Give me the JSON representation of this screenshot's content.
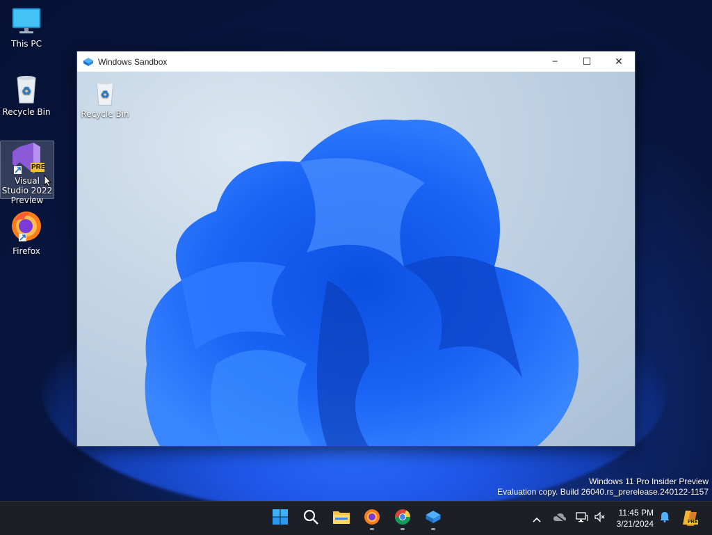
{
  "desktop": {
    "icons": [
      {
        "label": "This PC",
        "icon": "monitor-icon"
      },
      {
        "label": "Recycle Bin",
        "icon": "recycle-bin-icon"
      },
      {
        "label": "Visual Studio 2022 Preview",
        "icon": "visual-studio-icon",
        "badge": "PRE"
      },
      {
        "label": "Firefox",
        "icon": "firefox-icon"
      }
    ]
  },
  "sandbox_window": {
    "title": "Windows Sandbox",
    "controls": {
      "minimize": "─",
      "maximize": "☐",
      "close": "✕"
    },
    "inner_desktop": {
      "icons": [
        {
          "label": "Recycle Bin",
          "icon": "recycle-bin-icon"
        }
      ]
    }
  },
  "watermark": {
    "line1": "Windows 11 Pro Insider Preview",
    "line2": "Evaluation copy. Build 26040.rs_prerelease.240122-1157"
  },
  "taskbar": {
    "apps": [
      {
        "name": "Start",
        "icon": "windows-start-icon"
      },
      {
        "name": "Search",
        "icon": "search-icon"
      },
      {
        "name": "File Explorer",
        "icon": "folder-icon"
      },
      {
        "name": "Firefox",
        "icon": "firefox-icon",
        "running": true
      },
      {
        "name": "Chrome",
        "icon": "chrome-icon",
        "running": true
      },
      {
        "name": "Windows Sandbox",
        "icon": "sandbox-icon",
        "running": true
      }
    ],
    "clock": {
      "time": "11:45 PM",
      "date": "3/21/2024"
    },
    "copilot_badge": "PRE"
  },
  "colors": {
    "accent": "#1e63f0",
    "taskbar": "#1c1f26"
  }
}
